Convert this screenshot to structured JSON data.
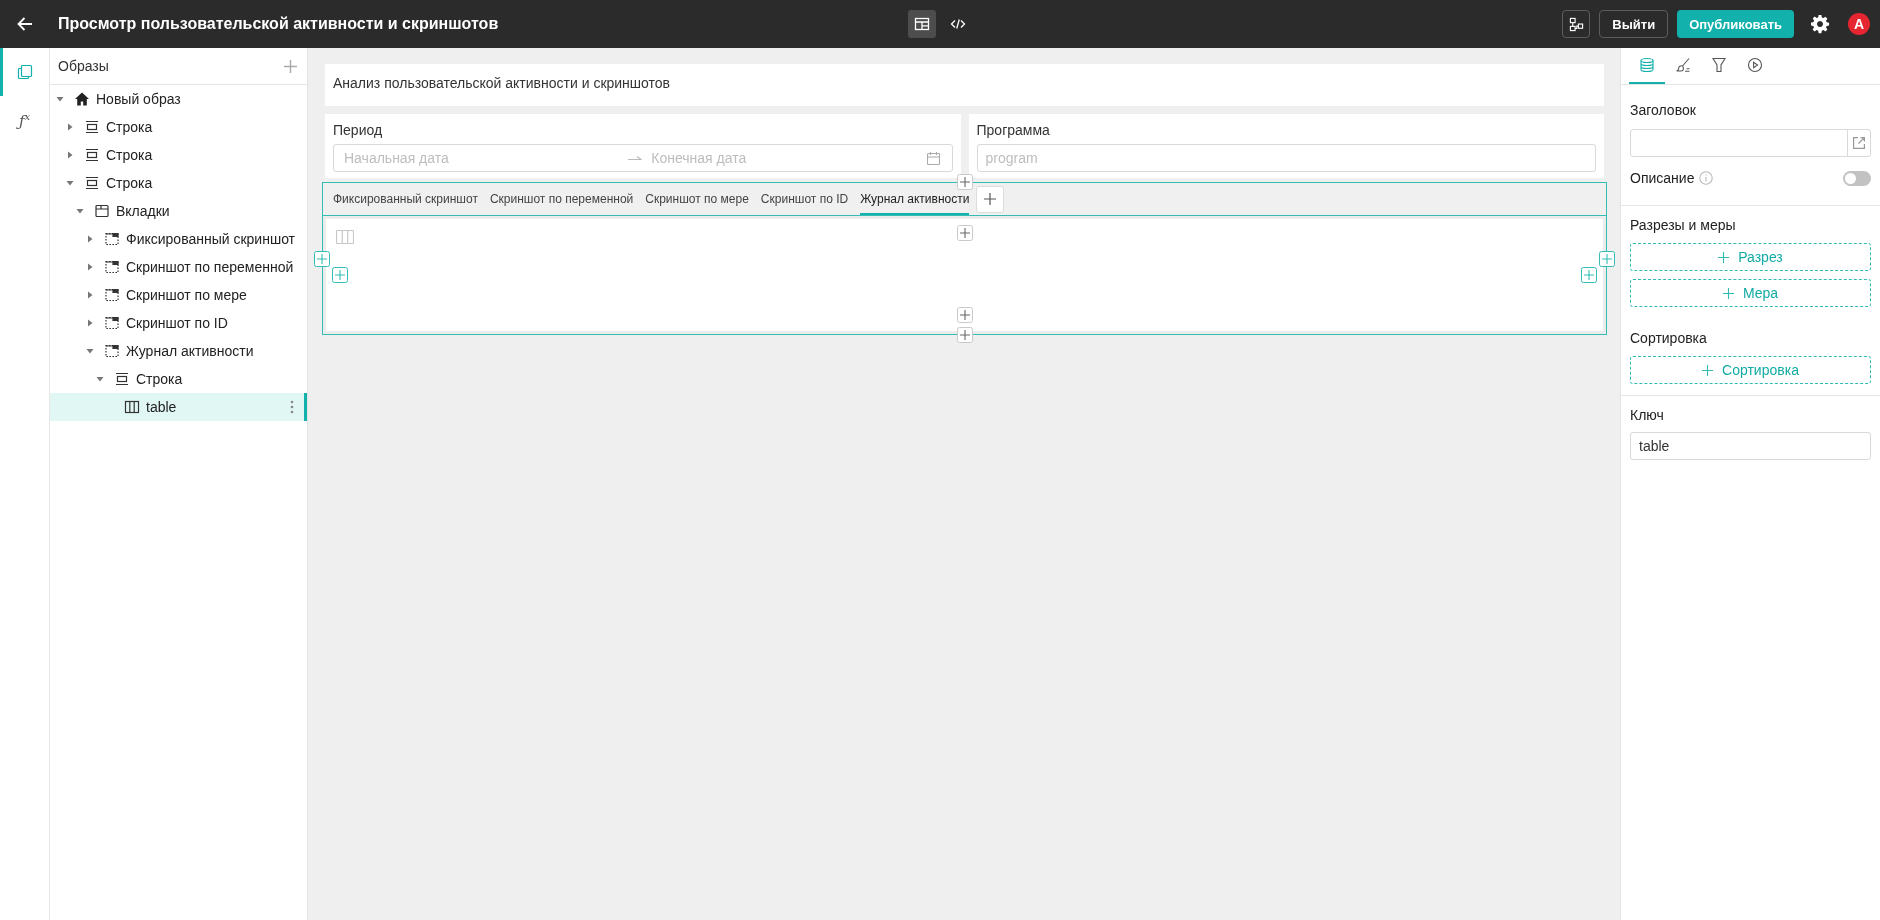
{
  "header": {
    "title": "Просмотр пользовательской активности и скриншотов",
    "view_modes": [
      {
        "kind": "layout",
        "selected": true
      },
      {
        "kind": "code",
        "selected": false
      }
    ],
    "exit_button": "Выйти",
    "publish_button": "Опубликовать",
    "avatar": "А"
  },
  "rail": [
    {
      "kind": "pages",
      "selected": true
    },
    {
      "kind": "formula",
      "label": "ƒ$^{x}$",
      "selected": false
    }
  ],
  "tree": {
    "title": "Образы",
    "items": [
      {
        "kind": "root",
        "label": "Новый образ",
        "expanded": true,
        "selected": false,
        "children": [
          {
            "kind": "row",
            "label": "Строка",
            "expanded": false,
            "selected": false
          },
          {
            "kind": "row",
            "label": "Строка",
            "expanded": false,
            "selected": false
          },
          {
            "kind": "row",
            "label": "Строка",
            "expanded": true,
            "selected": false,
            "children": [
              {
                "kind": "tabs",
                "label": "Вкладки",
                "expanded": true,
                "selected": false,
                "children": [
                  {
                    "kind": "tab",
                    "label": "Фиксированный скриншот",
                    "expanded": false,
                    "selected": false
                  },
                  {
                    "kind": "tab",
                    "label": "Скриншот по переменной",
                    "expanded": false,
                    "selected": false
                  },
                  {
                    "kind": "tab",
                    "label": "Скриншот по мере",
                    "expanded": false,
                    "selected": false
                  },
                  {
                    "kind": "tab",
                    "label": "Скриншот по ID",
                    "expanded": false,
                    "selected": false
                  },
                  {
                    "kind": "tab",
                    "label": "Журнал активности",
                    "expanded": true,
                    "selected": false,
                    "children": [
                      {
                        "kind": "row",
                        "label": "Строка",
                        "expanded": true,
                        "selected": false,
                        "children": [
                          {
                            "kind": "table",
                            "label": "table",
                            "selected": true
                          }
                        ]
                      }
                    ]
                  }
                ]
              }
            ]
          }
        ]
      }
    ]
  },
  "canvas": {
    "title": "Анализ пользовательской активности и скриншотов",
    "filters": [
      {
        "kind": "date_range",
        "label": "Период",
        "start": {
          "placeholder": "Начальная дата"
        },
        "end": {
          "placeholder": "Конечная дата"
        }
      },
      {
        "kind": "text",
        "label": "Программа",
        "placeholder": "program"
      }
    ],
    "tabs": [
      {
        "label": "Фиксированный скриншот",
        "selected": false
      },
      {
        "label": "Скриншот по переменной",
        "selected": false
      },
      {
        "label": "Скриншот по мере",
        "selected": false
      },
      {
        "label": "Скриншот по ID",
        "selected": false
      },
      {
        "label": "Журнал активности",
        "selected": true
      }
    ]
  },
  "inspector": {
    "tabs": [
      {
        "kind": "data",
        "selected": true
      },
      {
        "kind": "style",
        "selected": false
      },
      {
        "kind": "filter",
        "selected": false
      },
      {
        "kind": "actions",
        "selected": false
      }
    ],
    "title_label": "Заголовок",
    "description": {
      "label": "Описание",
      "on": false
    },
    "groups": [
      {
        "label": "Разрезы и меры",
        "buttons": [
          "Разрез",
          "Мера"
        ]
      },
      {
        "label": "Сортировка",
        "buttons": [
          "Сортировка"
        ]
      }
    ],
    "key": {
      "label": "Ключ",
      "value": "table"
    }
  }
}
